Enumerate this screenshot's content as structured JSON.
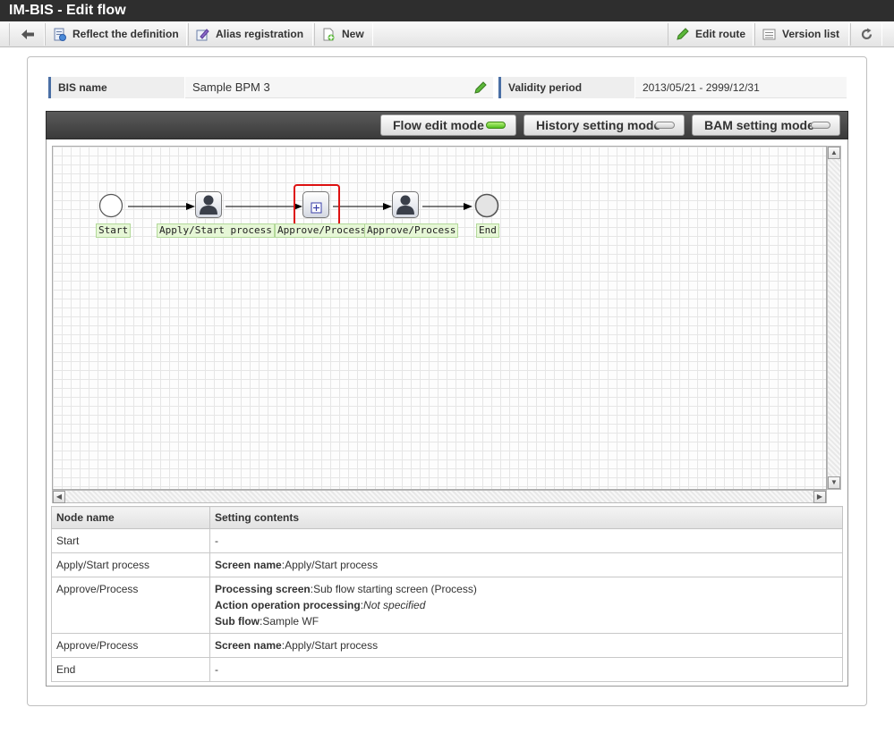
{
  "window": {
    "title": "IM-BIS - Edit flow"
  },
  "toolbar": {
    "back_icon": "back-arrow-icon",
    "reflect": "Reflect the definition",
    "alias": "Alias registration",
    "new": "New",
    "edit_route": "Edit route",
    "version_list": "Version list",
    "refresh_icon": "refresh-icon"
  },
  "info": {
    "bis_name_label": "BIS name",
    "bis_name_value": "Sample BPM 3",
    "validity_label": "Validity period",
    "validity_value": "2013/05/21 - 2999/12/31"
  },
  "modes": {
    "flow_edit": "Flow edit mode",
    "history": "History setting mode",
    "bam": "BAM setting mode",
    "active": "flow_edit"
  },
  "flow": {
    "nodes": [
      {
        "type": "start",
        "label": "Start"
      },
      {
        "type": "user",
        "label": "Apply/Start process"
      },
      {
        "type": "subflow",
        "label": "Approve/Process",
        "selected": true
      },
      {
        "type": "user",
        "label": "Approve/Process"
      },
      {
        "type": "end",
        "label": "End"
      }
    ]
  },
  "table": {
    "headers": [
      "Node name",
      "Setting contents"
    ],
    "rows": [
      {
        "name": "Start",
        "contents": [
          {
            "key": "",
            "value": "-"
          }
        ]
      },
      {
        "name": "Apply/Start process",
        "contents": [
          {
            "key": "Screen name",
            "value": "Apply/Start process"
          }
        ]
      },
      {
        "name": "Approve/Process",
        "contents": [
          {
            "key": "Processing screen",
            "value": "Sub flow starting screen (Process)"
          },
          {
            "key": "Action operation processing",
            "value": "Not specified",
            "italic": true
          },
          {
            "key": "Sub flow",
            "value": "Sample WF"
          }
        ]
      },
      {
        "name": "Approve/Process",
        "contents": [
          {
            "key": "Screen name",
            "value": "Apply/Start process"
          }
        ]
      },
      {
        "name": "End",
        "contents": [
          {
            "key": "",
            "value": "-"
          }
        ]
      }
    ]
  },
  "colors": {
    "titlebar": "#2e2e2e",
    "active_indicator": "#55c020",
    "selection_border": "#dd1111",
    "node_label_bg": "#e6f7d6"
  }
}
